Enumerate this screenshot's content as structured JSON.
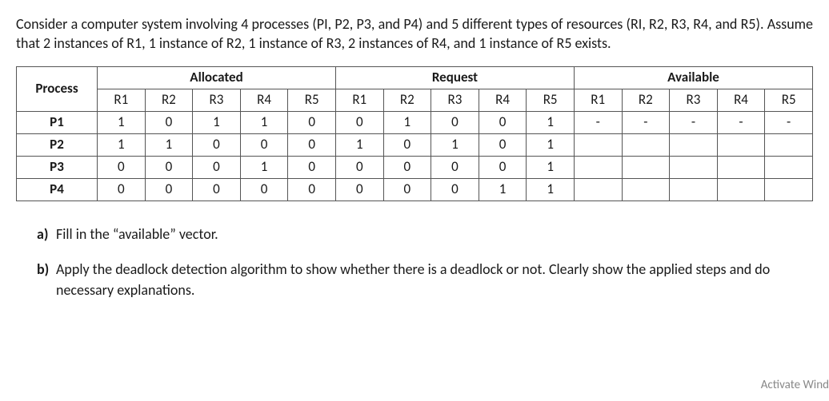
{
  "problem": {
    "text": "Consider a computer system involving 4 processes (PI, P2, P3, and P4) and 5 different types of resources (RI, R2, R3, R4, and R5). Assume that 2 instances of R1, 1 instance of R2, 1 instance of R3, 2 instances of R4, and 1 instance of R5 exists."
  },
  "table": {
    "process_header": "Process",
    "group_headers": [
      "Allocated",
      "Request",
      "Available"
    ],
    "subheaders": [
      "R1",
      "R2",
      "R3",
      "R4",
      "R5",
      "R1",
      "R2",
      "R3",
      "R4",
      "R5",
      "R1",
      "R2",
      "R3",
      "R4",
      "R5"
    ],
    "rows": [
      {
        "name": "P1",
        "allocated": [
          "1",
          "0",
          "1",
          "1",
          "0"
        ],
        "request": [
          "0",
          "1",
          "0",
          "0",
          "1"
        ],
        "available": [
          "-",
          "-",
          "-",
          "-",
          "-"
        ]
      },
      {
        "name": "P2",
        "allocated": [
          "1",
          "1",
          "0",
          "0",
          "0"
        ],
        "request": [
          "1",
          "0",
          "1",
          "0",
          "1"
        ],
        "available": [
          "",
          "",
          "",
          "",
          ""
        ]
      },
      {
        "name": "P3",
        "allocated": [
          "0",
          "0",
          "0",
          "1",
          "0"
        ],
        "request": [
          "0",
          "0",
          "0",
          "0",
          "1"
        ],
        "available": [
          "",
          "",
          "",
          "",
          ""
        ]
      },
      {
        "name": "P4",
        "allocated": [
          "0",
          "0",
          "0",
          "0",
          "0"
        ],
        "request": [
          "0",
          "0",
          "0",
          "1",
          "1"
        ],
        "available": [
          "",
          "",
          "",
          "",
          ""
        ]
      }
    ]
  },
  "questions": {
    "a": {
      "label": "a)",
      "text": "Fill in the “available” vector."
    },
    "b": {
      "label": "b)",
      "text": "Apply the deadlock detection algorithm to show whether there is a deadlock or not. Clearly show the applied steps and do necessary explanations."
    }
  },
  "watermark": "Activate Wind"
}
